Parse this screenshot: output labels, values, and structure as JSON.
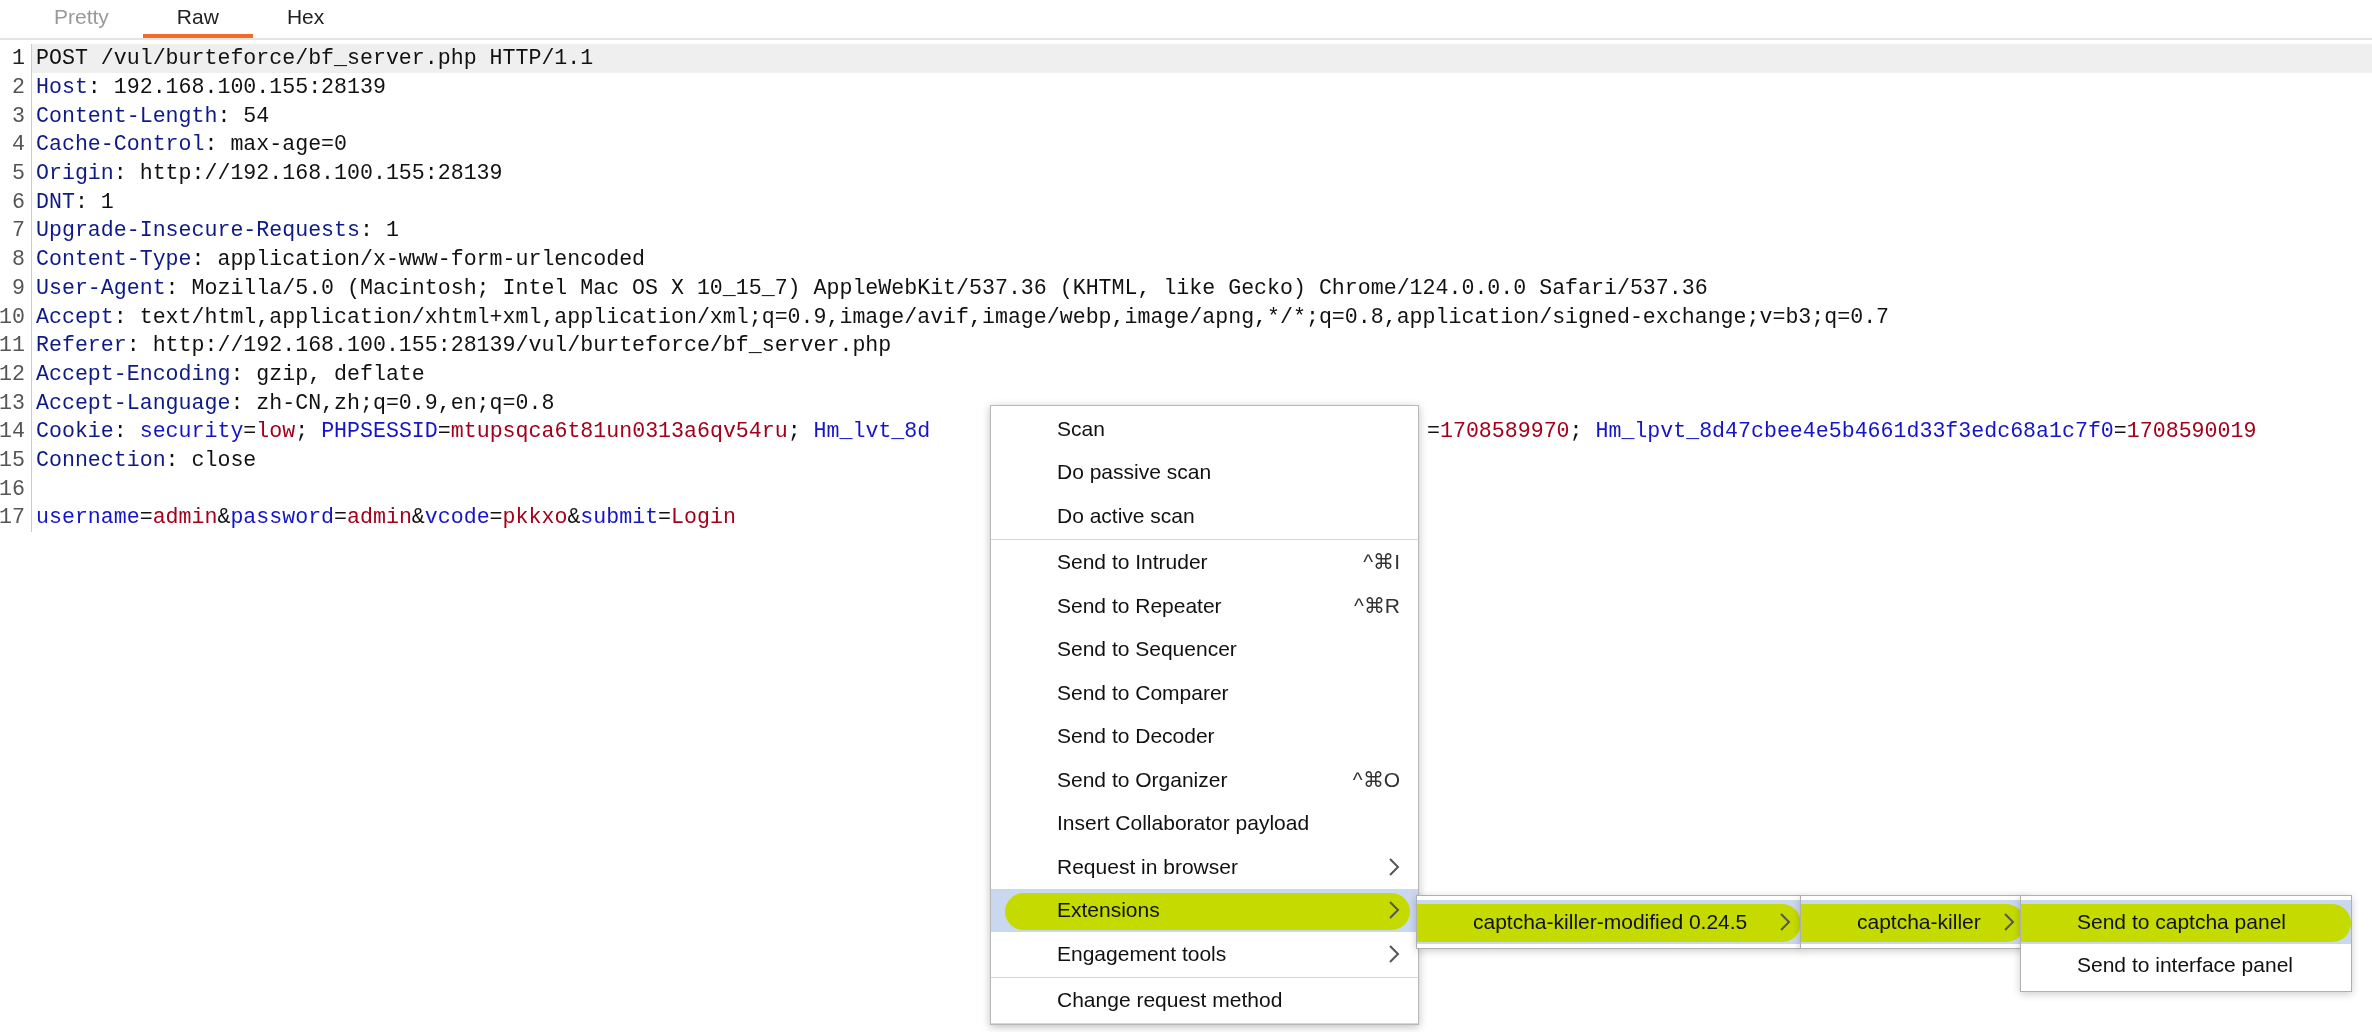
{
  "tabs": [
    {
      "label": "Pretty",
      "selected": false,
      "disabled": true
    },
    {
      "label": "Raw",
      "selected": true,
      "disabled": false
    },
    {
      "label": "Hex",
      "selected": false,
      "disabled": false
    }
  ],
  "editor": {
    "lines": [
      {
        "number": "1",
        "selected": true,
        "tokens": [
          {
            "text": "POST /vul/burteforce/bf_server.php HTTP/1.1",
            "kind": "plain"
          }
        ]
      },
      {
        "number": "2",
        "selected": false,
        "tokens": [
          {
            "text": "Host",
            "kind": "header"
          },
          {
            "text": ": 192.168.100.155:28139",
            "kind": "plain"
          }
        ]
      },
      {
        "number": "3",
        "selected": false,
        "tokens": [
          {
            "text": "Content-Length",
            "kind": "header"
          },
          {
            "text": ": 54",
            "kind": "plain"
          }
        ]
      },
      {
        "number": "4",
        "selected": false,
        "tokens": [
          {
            "text": "Cache-Control",
            "kind": "header"
          },
          {
            "text": ": max-age=0",
            "kind": "plain"
          }
        ]
      },
      {
        "number": "5",
        "selected": false,
        "tokens": [
          {
            "text": "Origin",
            "kind": "header"
          },
          {
            "text": ": http://192.168.100.155:28139",
            "kind": "plain"
          }
        ]
      },
      {
        "number": "6",
        "selected": false,
        "tokens": [
          {
            "text": "DNT",
            "kind": "header"
          },
          {
            "text": ": 1",
            "kind": "plain"
          }
        ]
      },
      {
        "number": "7",
        "selected": false,
        "tokens": [
          {
            "text": "Upgrade-Insecure-Requests",
            "kind": "header"
          },
          {
            "text": ": 1",
            "kind": "plain"
          }
        ]
      },
      {
        "number": "8",
        "selected": false,
        "tokens": [
          {
            "text": "Content-Type",
            "kind": "header"
          },
          {
            "text": ": application/x-www-form-urlencoded",
            "kind": "plain"
          }
        ]
      },
      {
        "number": "9",
        "selected": false,
        "tokens": [
          {
            "text": "User-Agent",
            "kind": "header"
          },
          {
            "text": ": Mozilla/5.0 (Macintosh; Intel Mac OS X 10_15_7) AppleWebKit/537.36 (KHTML, like Gecko) Chrome/124.0.0.0 Safari/537.36",
            "kind": "plain"
          }
        ]
      },
      {
        "number": "10",
        "selected": false,
        "tokens": [
          {
            "text": "Accept",
            "kind": "header"
          },
          {
            "text": ": text/html,application/xhtml+xml,application/xml;q=0.9,image/avif,image/webp,image/apng,*/*;q=0.8,application/signed-exchange;v=b3;q=0.7",
            "kind": "plain"
          }
        ]
      },
      {
        "number": "11",
        "selected": false,
        "tokens": [
          {
            "text": "Referer",
            "kind": "header"
          },
          {
            "text": ": http://192.168.100.155:28139/vul/burteforce/bf_server.php",
            "kind": "plain"
          }
        ]
      },
      {
        "number": "12",
        "selected": false,
        "tokens": [
          {
            "text": "Accept-Encoding",
            "kind": "header"
          },
          {
            "text": ": gzip, deflate",
            "kind": "plain"
          }
        ]
      },
      {
        "number": "13",
        "selected": false,
        "tokens": [
          {
            "text": "Accept-Language",
            "kind": "header"
          },
          {
            "text": ": zh-CN,zh;q=0.9,en;q=0.8",
            "kind": "plain"
          }
        ]
      },
      {
        "number": "14",
        "selected": false,
        "tokens": [
          {
            "text": "Cookie",
            "kind": "header"
          },
          {
            "text": ": ",
            "kind": "plain"
          },
          {
            "text": "security",
            "kind": "param"
          },
          {
            "text": "=",
            "kind": "plain"
          },
          {
            "text": "low",
            "kind": "value"
          },
          {
            "text": "; ",
            "kind": "plain"
          },
          {
            "text": "PHPSESSID",
            "kind": "param"
          },
          {
            "text": "=",
            "kind": "plain"
          },
          {
            "text": "mtupsqca6t81un0313a6qv54ru",
            "kind": "value"
          },
          {
            "text": "; ",
            "kind": "plain"
          },
          {
            "text": "Hm_lvt_8d",
            "kind": "param"
          }
        ],
        "tail": [
          {
            "text": "=",
            "kind": "plain"
          },
          {
            "text": "1708589970",
            "kind": "value"
          },
          {
            "text": "; ",
            "kind": "plain"
          },
          {
            "text": "Hm_lpvt_8d47cbee4e5b4661d33f3edc68a1c7f0",
            "kind": "param"
          },
          {
            "text": "=",
            "kind": "plain"
          },
          {
            "text": "1708590019",
            "kind": "value"
          }
        ]
      },
      {
        "number": "15",
        "selected": false,
        "tokens": [
          {
            "text": "Connection",
            "kind": "header"
          },
          {
            "text": ": close",
            "kind": "plain"
          }
        ]
      },
      {
        "number": "16",
        "selected": false
      },
      {
        "number": "17",
        "selected": false,
        "tokens": [
          {
            "text": "username",
            "kind": "param"
          },
          {
            "text": "=",
            "kind": "plain"
          },
          {
            "text": "admin",
            "kind": "value"
          },
          {
            "text": "&",
            "kind": "plain"
          },
          {
            "text": "password",
            "kind": "param"
          },
          {
            "text": "=",
            "kind": "plain"
          },
          {
            "text": "admin",
            "kind": "value"
          },
          {
            "text": "&",
            "kind": "plain"
          },
          {
            "text": "vcode",
            "kind": "param"
          },
          {
            "text": "=",
            "kind": "plain"
          },
          {
            "text": "pkkxo",
            "kind": "value"
          },
          {
            "text": "&",
            "kind": "plain"
          },
          {
            "text": "submit",
            "kind": "param"
          },
          {
            "text": "=",
            "kind": "plain"
          },
          {
            "text": "Login",
            "kind": "value"
          }
        ]
      }
    ]
  },
  "context_menu": {
    "groups": [
      [
        {
          "label": "Scan",
          "selected": false,
          "highlighted": false,
          "has_submenu": false
        },
        {
          "label": "Do passive scan",
          "selected": false,
          "highlighted": false,
          "has_submenu": false
        },
        {
          "label": "Do active scan",
          "selected": false,
          "highlighted": false,
          "has_submenu": false
        }
      ],
      [
        {
          "label": "Send to Intruder",
          "shortcut": "^⌘I",
          "selected": false,
          "highlighted": false,
          "has_submenu": false
        },
        {
          "label": "Send to Repeater",
          "shortcut": "^⌘R",
          "selected": false,
          "highlighted": false,
          "has_submenu": false
        },
        {
          "label": "Send to Sequencer",
          "selected": false,
          "highlighted": false,
          "has_submenu": false
        },
        {
          "label": "Send to Comparer",
          "selected": false,
          "highlighted": false,
          "has_submenu": false
        },
        {
          "label": "Send to Decoder",
          "selected": false,
          "highlighted": false,
          "has_submenu": false
        },
        {
          "label": "Send to Organizer",
          "shortcut": "^⌘O",
          "selected": false,
          "highlighted": false,
          "has_submenu": false
        },
        {
          "label": "Insert Collaborator payload",
          "selected": false,
          "highlighted": false,
          "has_submenu": false
        },
        {
          "label": "Request in browser",
          "selected": false,
          "highlighted": false,
          "has_submenu": true
        },
        {
          "label": "Extensions",
          "selected": true,
          "highlighted": true,
          "has_submenu": true
        },
        {
          "label": "Engagement tools",
          "selected": false,
          "highlighted": false,
          "has_submenu": true
        }
      ],
      [
        {
          "label": "Change request method",
          "selected": false,
          "highlighted": false,
          "has_submenu": false
        }
      ]
    ]
  },
  "submenus": [
    {
      "items": [
        {
          "label": "captcha-killer-modified 0.24.5",
          "selected": true,
          "highlighted": true,
          "has_submenu": true
        }
      ]
    },
    {
      "items": [
        {
          "label": "captcha-killer",
          "selected": true,
          "highlighted": true,
          "has_submenu": true
        }
      ]
    },
    {
      "items": [
        {
          "label": "Send to captcha panel",
          "selected": true,
          "highlighted": true,
          "has_submenu": false
        },
        {
          "label": "Send to interface panel",
          "selected": false,
          "highlighted": false,
          "has_submenu": false
        }
      ]
    }
  ]
}
